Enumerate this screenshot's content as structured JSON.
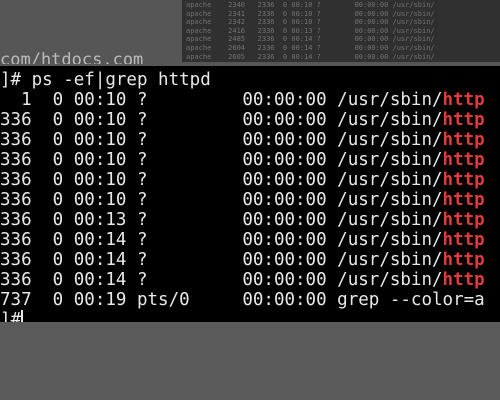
{
  "top_sliver": {
    "prompt_tail": "",
    "host_text": "com/htdocs.com"
  },
  "background_thumbnail": {
    "lines": [
      "apache    2340   2336  0 00:10 ?        00:00:00 /usr/sbin/",
      "apache    2341   2336  0 00:10 ?        00:00:00 /usr/sbin/",
      "apache    2342   2336  0 00:10 ?        00:00:00 /usr/sbin/",
      "apache    2416   2336  0 00:13 ?        00:00:00 /usr/sbin/",
      "apache    2485   2336  0 00:14 ?        00:00:00 /usr/sbin/",
      "apache    2604   2336  0 00:14 ?        00:00:00 /usr/sbin/",
      "apache    2605   2336  0 00:14 ?        00:00:00 /usr/sbin/"
    ]
  },
  "terminal": {
    "command_line": {
      "prompt": "]#",
      "command": " ps -ef|grep httpd"
    },
    "process_rows": [
      {
        "pid_tail": "  1",
        "c": "  0",
        "stime": " 00:10",
        "tty": " ?      ",
        "time": "   00:00:00",
        "cmd_prefix": " /usr/sbin/",
        "cmd_match": "http"
      },
      {
        "pid_tail": "336",
        "c": "  0",
        "stime": " 00:10",
        "tty": " ?      ",
        "time": "   00:00:00",
        "cmd_prefix": " /usr/sbin/",
        "cmd_match": "http"
      },
      {
        "pid_tail": "336",
        "c": "  0",
        "stime": " 00:10",
        "tty": " ?      ",
        "time": "   00:00:00",
        "cmd_prefix": " /usr/sbin/",
        "cmd_match": "http"
      },
      {
        "pid_tail": "336",
        "c": "  0",
        "stime": " 00:10",
        "tty": " ?      ",
        "time": "   00:00:00",
        "cmd_prefix": " /usr/sbin/",
        "cmd_match": "http"
      },
      {
        "pid_tail": "336",
        "c": "  0",
        "stime": " 00:10",
        "tty": " ?      ",
        "time": "   00:00:00",
        "cmd_prefix": " /usr/sbin/",
        "cmd_match": "http"
      },
      {
        "pid_tail": "336",
        "c": "  0",
        "stime": " 00:10",
        "tty": " ?      ",
        "time": "   00:00:00",
        "cmd_prefix": " /usr/sbin/",
        "cmd_match": "http"
      },
      {
        "pid_tail": "336",
        "c": "  0",
        "stime": " 00:13",
        "tty": " ?      ",
        "time": "   00:00:00",
        "cmd_prefix": " /usr/sbin/",
        "cmd_match": "http"
      },
      {
        "pid_tail": "336",
        "c": "  0",
        "stime": " 00:14",
        "tty": " ?      ",
        "time": "   00:00:00",
        "cmd_prefix": " /usr/sbin/",
        "cmd_match": "http"
      },
      {
        "pid_tail": "336",
        "c": "  0",
        "stime": " 00:14",
        "tty": " ?      ",
        "time": "   00:00:00",
        "cmd_prefix": " /usr/sbin/",
        "cmd_match": "http"
      },
      {
        "pid_tail": "336",
        "c": "  0",
        "stime": " 00:14",
        "tty": " ?      ",
        "time": "   00:00:00",
        "cmd_prefix": " /usr/sbin/",
        "cmd_match": "http"
      }
    ],
    "grep_row": {
      "pid_tail": "737",
      "c": "  0",
      "stime": " 00:19",
      "tty": " pts/0  ",
      "time": "   00:00:00",
      "cmd": " grep --color=a"
    },
    "final_prompt": "]#"
  },
  "colors": {
    "terminal_bg": "#000000",
    "terminal_fg": "#e8e8e8",
    "grep_highlight": "#e23a3a",
    "page_bg": "#5c5c5c"
  }
}
